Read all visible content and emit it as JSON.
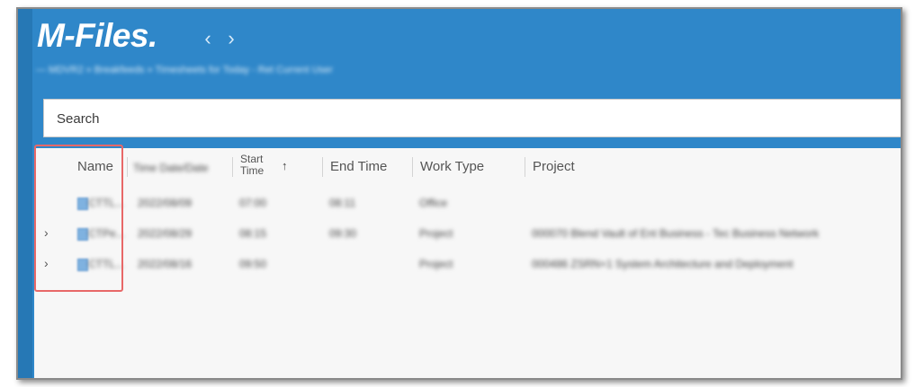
{
  "app": {
    "logo_text": "M-Files",
    "logo_dot": ".",
    "back_glyph": "‹",
    "forward_glyph": "›",
    "breadcrumb": "— MDVR2 » Breakfeeds » Timesheets for Today - Ret Current User",
    "accent_color": "#2f87c9",
    "highlight_color": "#e86868"
  },
  "search": {
    "placeholder": "Search"
  },
  "columns": {
    "name": "Name",
    "time_date_col": "Time Date/Date",
    "start_time": "Start Time",
    "sort_icon": "↑",
    "end_time": "End Time",
    "work_type": "Work Type",
    "project": "Project"
  },
  "rows": [
    {
      "expandable": false,
      "name": "CTTL...",
      "date": "2022/08/09",
      "start": "07:00",
      "end": "08:11",
      "work_type": "Office",
      "project": ""
    },
    {
      "expandable": true,
      "expander_glyph": "›",
      "name": "CTPe...",
      "date": "2022/08/29",
      "start": "08:15",
      "end": "09:30",
      "work_type": "Project",
      "project": "000070 Blend Vault of Ent Business - Tec Business Network"
    },
    {
      "expandable": true,
      "expander_glyph": "›",
      "name": "CTTL...",
      "date": "2022/08/16",
      "start": "09:50",
      "end": "",
      "work_type": "Project",
      "project": "000486 ZSRN+1 System Architecture and Deployment"
    }
  ]
}
